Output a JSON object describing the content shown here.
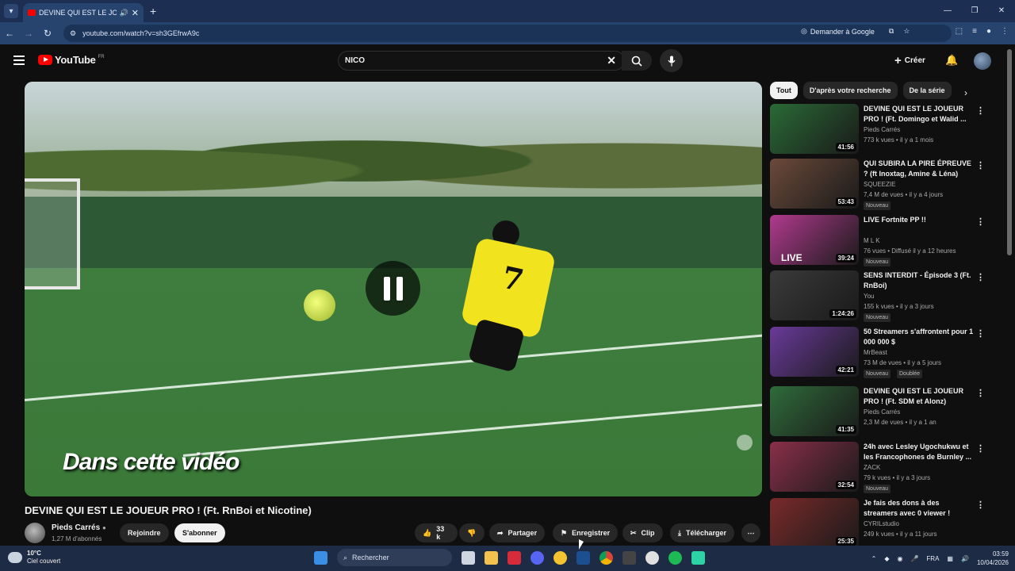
{
  "browser": {
    "tab_title": "DEVINE QUI EST LE JOUEUR PRO ! (Ft. RnBoi et Nicotine)",
    "url": "youtube.com/watch?v=sh3GEfrwA9c",
    "ask_google_label": "Demander à Google"
  },
  "header": {
    "logo_text": "YouTube",
    "logo_region": "FR",
    "search_value": "NICO",
    "create_label": "Créer"
  },
  "player": {
    "caption_text": "Dans cette vidéo",
    "shirt_number": "7"
  },
  "video": {
    "title": "DEVINE QUI EST LE JOUEUR PRO ! (Ft. RnBoi et Nicotine)",
    "channel_name": "Pieds Carrés",
    "subscribers": "1,27 M d'abonnés",
    "join_label": "Rejoindre",
    "subscribe_label": "S'abonner",
    "likes": "33 k",
    "share_label": "Partager",
    "save_label": "Enregistrer",
    "clip_label": "Clip",
    "download_label": "Télécharger"
  },
  "filters": [
    "Tout",
    "D'après votre recherche",
    "De la série"
  ],
  "recommendations": [
    {
      "title": "DEVINE QUI EST LE JOUEUR PRO ! (Ft. Domingo et Walid ...",
      "channel": "Pieds Carrés",
      "meta": "773 k vues • il y a 1 mois",
      "duration": "41:56",
      "badge": "",
      "badge2": "",
      "thumb_color": "#2a6a36"
    },
    {
      "title": "QUI SUBIRA LA PIRE ÉPREUVE ? (ft Inoxtag, Amine & Léna)",
      "channel": "SQUEEZIE",
      "meta": "7,4 M de vues • il y a 4 jours",
      "duration": "53:43",
      "badge": "Nouveau",
      "badge2": "",
      "thumb_color": "#6b4a3a"
    },
    {
      "title": "LIVE Fortnite PP !!",
      "channel": "M L K",
      "meta": "76 vues • Diffusé il y a 12 heures",
      "duration": "39:24",
      "badge": "Nouveau",
      "badge2": "",
      "thumb_color": "#b13a8e",
      "live_text": "LIVE"
    },
    {
      "title": "SENS INTERDIT - Épisode 3 (Ft. RnBoi)",
      "channel": "You",
      "meta": "155 k vues • il y a 3 jours",
      "duration": "1:24:26",
      "badge": "Nouveau",
      "badge2": "",
      "thumb_color": "#3a3a3a"
    },
    {
      "title": "50 Streamers s'affrontent pour 1 000 000 $",
      "channel": "MrBeast",
      "meta": "73 M de vues • il y a 5 jours",
      "duration": "42:21",
      "badge": "Nouveau",
      "badge2": "Doublée",
      "thumb_color": "#6a3a9a"
    },
    {
      "title": "DEVINE QUI EST LE JOUEUR PRO ! (Ft. SDM et Alonz)",
      "channel": "Pieds Carrés",
      "meta": "2,3 M de vues • il y a 1 an",
      "duration": "41:35",
      "badge": "",
      "badge2": "",
      "thumb_color": "#2f6b3a"
    },
    {
      "title": "24h avec Lesley Ugochukwu et les Francophones de Burnley ...",
      "channel": "ZACK",
      "meta": "79 k vues • il y a 3 jours",
      "duration": "32:54",
      "badge": "Nouveau",
      "badge2": "",
      "thumb_color": "#8a2f4a"
    },
    {
      "title": "Je fais des dons à des streamers avec 0 viewer !",
      "channel": "CYRILstudio",
      "meta": "249 k vues • il y a 11 jours",
      "duration": "25:35",
      "badge": "",
      "badge2": "",
      "thumb_color": "#7a2a2a"
    }
  ],
  "taskbar": {
    "temperature": "10°C",
    "weather": "Ciel couvert",
    "search_label": "Rechercher",
    "language": "FRA",
    "time": "03:59",
    "date": "10/04/2026"
  }
}
